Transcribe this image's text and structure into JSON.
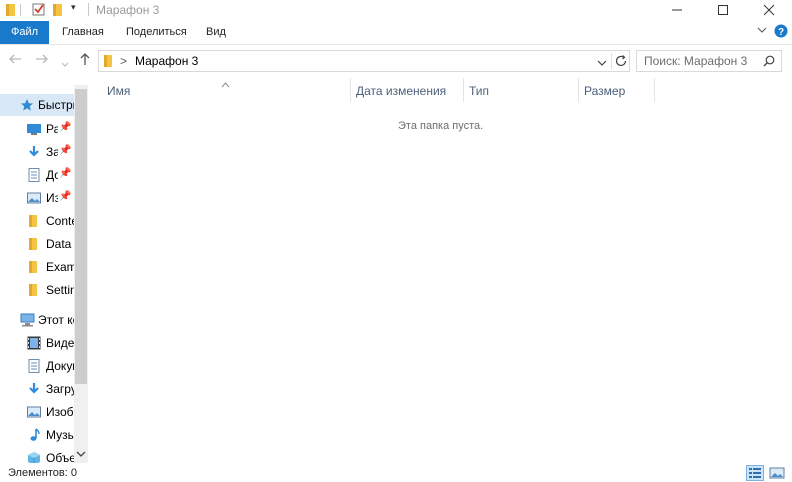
{
  "window": {
    "title": "Марафон 3"
  },
  "ribbon": {
    "tabs": [
      "Файл",
      "Главная",
      "Поделиться",
      "Вид"
    ]
  },
  "navigation": {
    "breadcrumb_separator": ">",
    "address": "Марафон 3",
    "search_placeholder": "Поиск: Марафон 3"
  },
  "sidebar": {
    "quick_access": "Быстрый доступ",
    "pinned": [
      {
        "label": "Рабочий стол",
        "icon": "desktop-icon"
      },
      {
        "label": "Загрузки",
        "icon": "download-icon"
      },
      {
        "label": "Документы",
        "icon": "document-icon"
      },
      {
        "label": "Изображения",
        "icon": "picture-icon"
      }
    ],
    "folders": [
      "Content",
      "Data",
      "Examples",
      "Settings"
    ],
    "this_pc": "Этот компьютер",
    "pc_items": [
      {
        "label": "Видео",
        "icon": "video-icon"
      },
      {
        "label": "Документы",
        "icon": "document-icon"
      },
      {
        "label": "Загрузки",
        "icon": "download-icon"
      },
      {
        "label": "Изображения",
        "icon": "picture-icon"
      },
      {
        "label": "Музыка",
        "icon": "music-icon"
      },
      {
        "label": "Объемные объекты",
        "icon": "3d-objects-icon"
      }
    ]
  },
  "columns": [
    "Имя",
    "Дата изменения",
    "Тип",
    "Размер"
  ],
  "empty_message": "Эта папка пуста.",
  "status": {
    "items": "Элементов: 0"
  },
  "colors": {
    "file_tab": "#1979ca",
    "folder": "#f4c542",
    "selected": "#d9e8f6",
    "column_text": "#4c607a"
  }
}
